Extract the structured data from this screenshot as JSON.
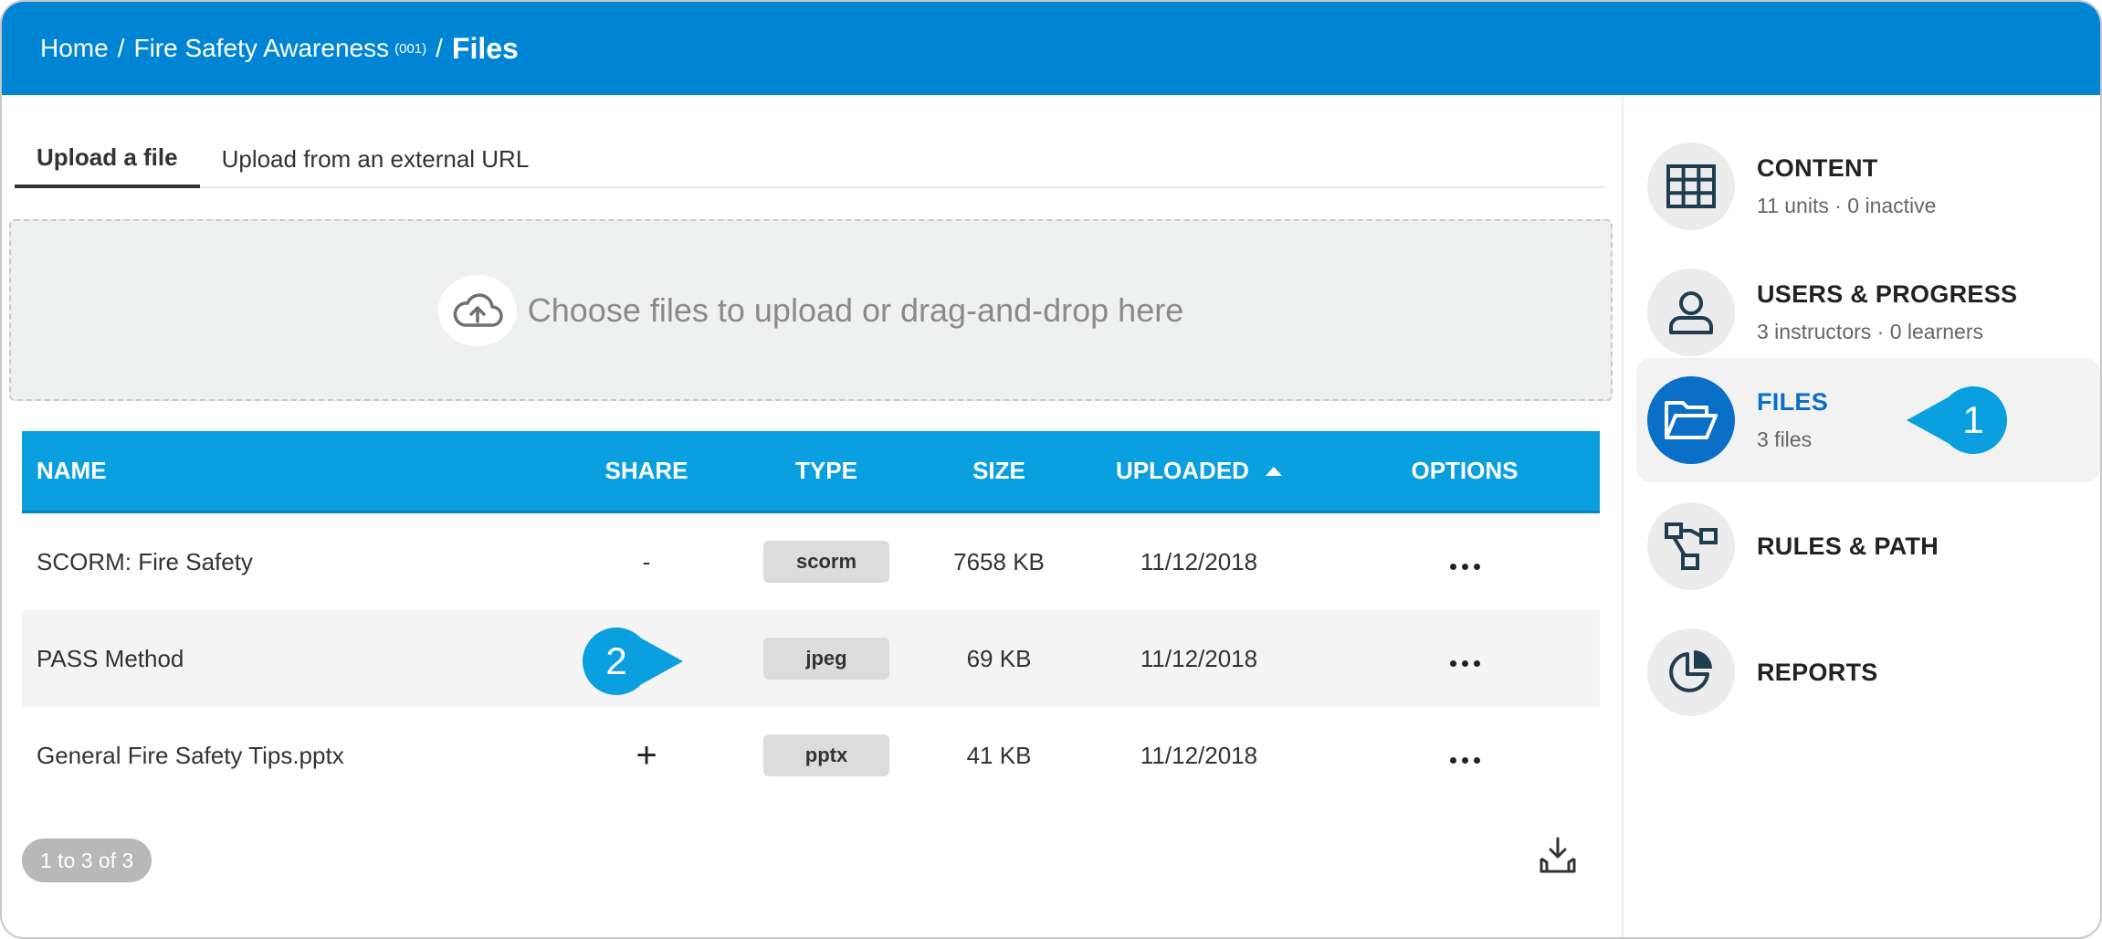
{
  "breadcrumb": {
    "home": "Home",
    "separator": "/",
    "course": "Fire Safety Awareness",
    "course_code": "(001)",
    "current": "Files"
  },
  "tabs": [
    {
      "label": "Upload a file",
      "active": true
    },
    {
      "label": "Upload from an external URL",
      "active": false
    }
  ],
  "dropzone": {
    "icon": "cloud-upload-icon",
    "text": "Choose files to upload or drag-and-drop here"
  },
  "table": {
    "headers": {
      "name": "NAME",
      "share": "SHARE",
      "type": "TYPE",
      "size": "SIZE",
      "uploaded": "UPLOADED",
      "options": "OPTIONS"
    },
    "sort": {
      "column": "uploaded",
      "direction": "ascending"
    },
    "rows": [
      {
        "name": "SCORM: Fire Safety",
        "share": "-",
        "type": "scorm",
        "size": "7658 KB",
        "uploaded": "11/12/2018"
      },
      {
        "name": "PASS Method",
        "share": "+",
        "type": "jpeg",
        "size": "69 KB",
        "uploaded": "11/12/2018"
      },
      {
        "name": "General Fire Safety Tips.pptx",
        "share": "+",
        "type": "pptx",
        "size": "41 KB",
        "uploaded": "11/12/2018"
      }
    ]
  },
  "pager": {
    "text": "1 to 3 of 3"
  },
  "sidebar": {
    "items": [
      {
        "title": "CONTENT",
        "subtitle": "11 units · 0 inactive",
        "icon": "grid-icon",
        "active": false
      },
      {
        "title": "USERS & PROGRESS",
        "subtitle": "3 instructors · 0 learners",
        "icon": "user-icon",
        "active": false
      },
      {
        "title": "FILES",
        "subtitle": "3 files",
        "icon": "folder-open-icon",
        "active": true
      },
      {
        "title": "RULES & PATH",
        "subtitle": "",
        "icon": "flow-path-icon",
        "active": false
      },
      {
        "title": "REPORTS",
        "subtitle": "",
        "icon": "pie-chart-icon",
        "active": false
      }
    ]
  },
  "callouts": [
    {
      "number": "1"
    },
    {
      "number": "2"
    }
  ],
  "colors": {
    "header_blue": "#0085d5",
    "table_header": "#0a9fde",
    "active_blue": "#0a6fc6",
    "callout": "#0a9fde"
  }
}
